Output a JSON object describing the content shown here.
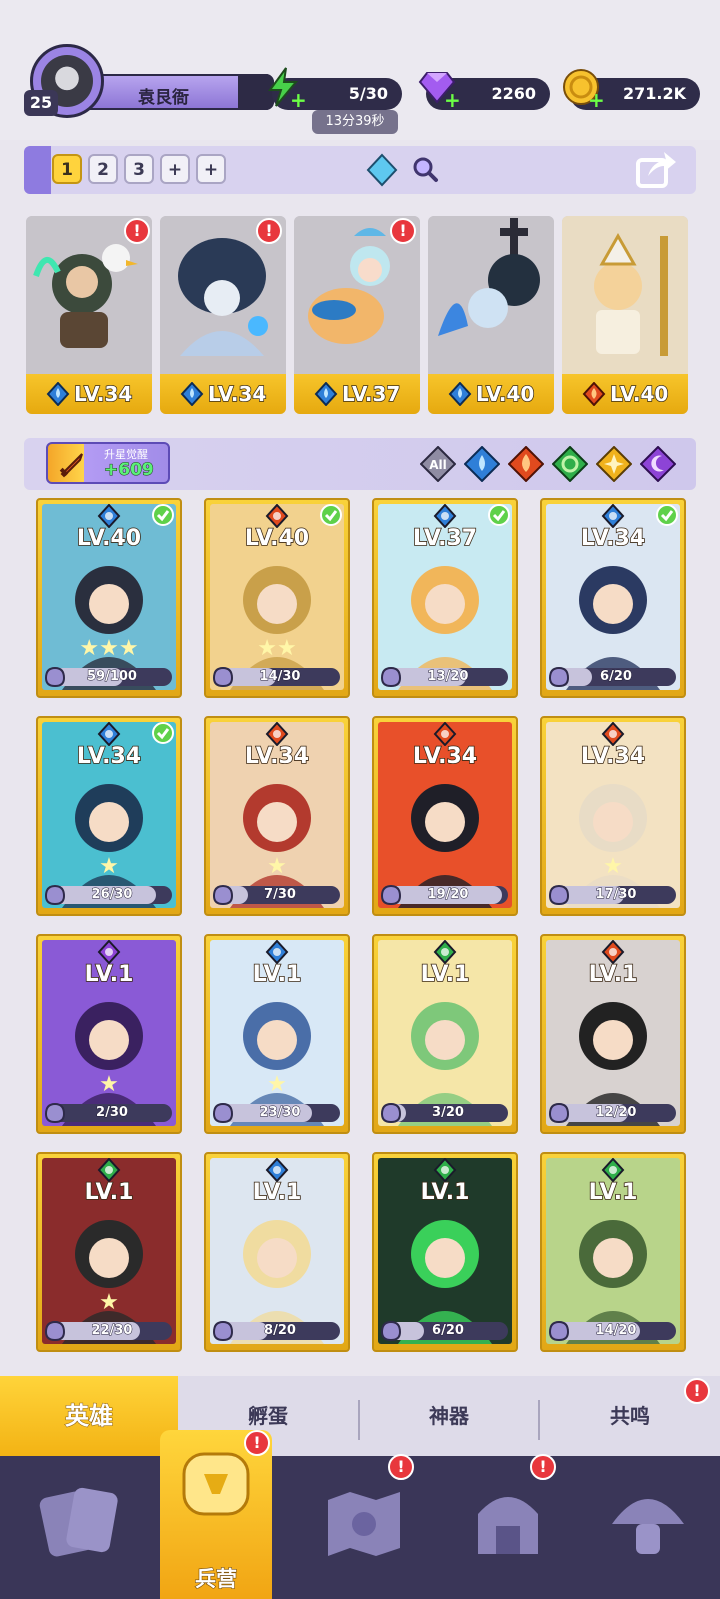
{
  "player": {
    "level": "25",
    "name": "袁艮衙"
  },
  "resources": {
    "energy": "5/30",
    "energy_timer": "13分39秒",
    "gems": "2260",
    "gold": "271.2K"
  },
  "team_slots": [
    "1",
    "2",
    "3",
    "+",
    "+"
  ],
  "team": [
    {
      "level": "LV.34",
      "element": "water",
      "alert": true
    },
    {
      "level": "LV.34",
      "element": "water",
      "alert": true
    },
    {
      "level": "LV.37",
      "element": "water",
      "alert": true
    },
    {
      "level": "LV.40",
      "element": "water",
      "alert": false
    },
    {
      "level": "LV.40",
      "element": "fire",
      "alert": false
    }
  ],
  "awaken": {
    "title": "升星觉醒",
    "value": "+609"
  },
  "filters": [
    "All",
    "water",
    "fire",
    "nature",
    "light",
    "dark"
  ],
  "heroes": [
    {
      "level": "LV.40",
      "element": "water",
      "shards": "59/100",
      "progress": 0.59,
      "checked": true,
      "stars": "★★★"
    },
    {
      "level": "LV.40",
      "element": "fire",
      "shards": "14/30",
      "progress": 0.47,
      "checked": true,
      "stars": "★★"
    },
    {
      "level": "LV.37",
      "element": "water",
      "shards": "13/20",
      "progress": 0.65,
      "checked": true,
      "stars": ""
    },
    {
      "level": "LV.34",
      "element": "water",
      "shards": "6/20",
      "progress": 0.3,
      "checked": true,
      "stars": ""
    },
    {
      "level": "LV.34",
      "element": "water",
      "shards": "26/30",
      "progress": 0.87,
      "checked": true,
      "stars": "★"
    },
    {
      "level": "LV.34",
      "element": "fire",
      "shards": "7/30",
      "progress": 0.23,
      "checked": false,
      "stars": "★"
    },
    {
      "level": "LV.34",
      "element": "fire",
      "shards": "19/20",
      "progress": 0.95,
      "checked": false,
      "stars": ""
    },
    {
      "level": "LV.34",
      "element": "fire",
      "shards": "17/30",
      "progress": 0.57,
      "checked": false,
      "stars": "★"
    },
    {
      "level": "LV.1",
      "element": "dark",
      "shards": "2/30",
      "progress": 0.07,
      "checked": false,
      "stars": "★"
    },
    {
      "level": "LV.1",
      "element": "water",
      "shards": "23/30",
      "progress": 0.77,
      "checked": false,
      "stars": "★"
    },
    {
      "level": "LV.1",
      "element": "nature",
      "shards": "3/20",
      "progress": 0.15,
      "checked": false,
      "stars": ""
    },
    {
      "level": "LV.1",
      "element": "fire",
      "shards": "12/20",
      "progress": 0.6,
      "checked": false,
      "stars": ""
    },
    {
      "level": "LV.1",
      "element": "nature",
      "shards": "22/30",
      "progress": 0.73,
      "checked": false,
      "stars": "★"
    },
    {
      "level": "LV.1",
      "element": "water",
      "shards": "8/20",
      "progress": 0.4,
      "checked": false,
      "stars": ""
    },
    {
      "level": "LV.1",
      "element": "nature",
      "shards": "6/20",
      "progress": 0.3,
      "checked": false,
      "stars": ""
    },
    {
      "level": "LV.1",
      "element": "nature",
      "shards": "14/20",
      "progress": 0.7,
      "checked": false,
      "stars": ""
    }
  ],
  "subtabs": [
    "英雄",
    "孵蛋",
    "神器",
    "共鸣"
  ],
  "bottom_nav": {
    "active_label": "兵营"
  },
  "colors": {
    "water": "#2f7fd8",
    "fire": "#e04a1e",
    "nature": "#2fae4a",
    "light": "#f0b21d",
    "dark": "#8d44d6",
    "gold": "#f5c12c",
    "panel": "#3a3658"
  }
}
